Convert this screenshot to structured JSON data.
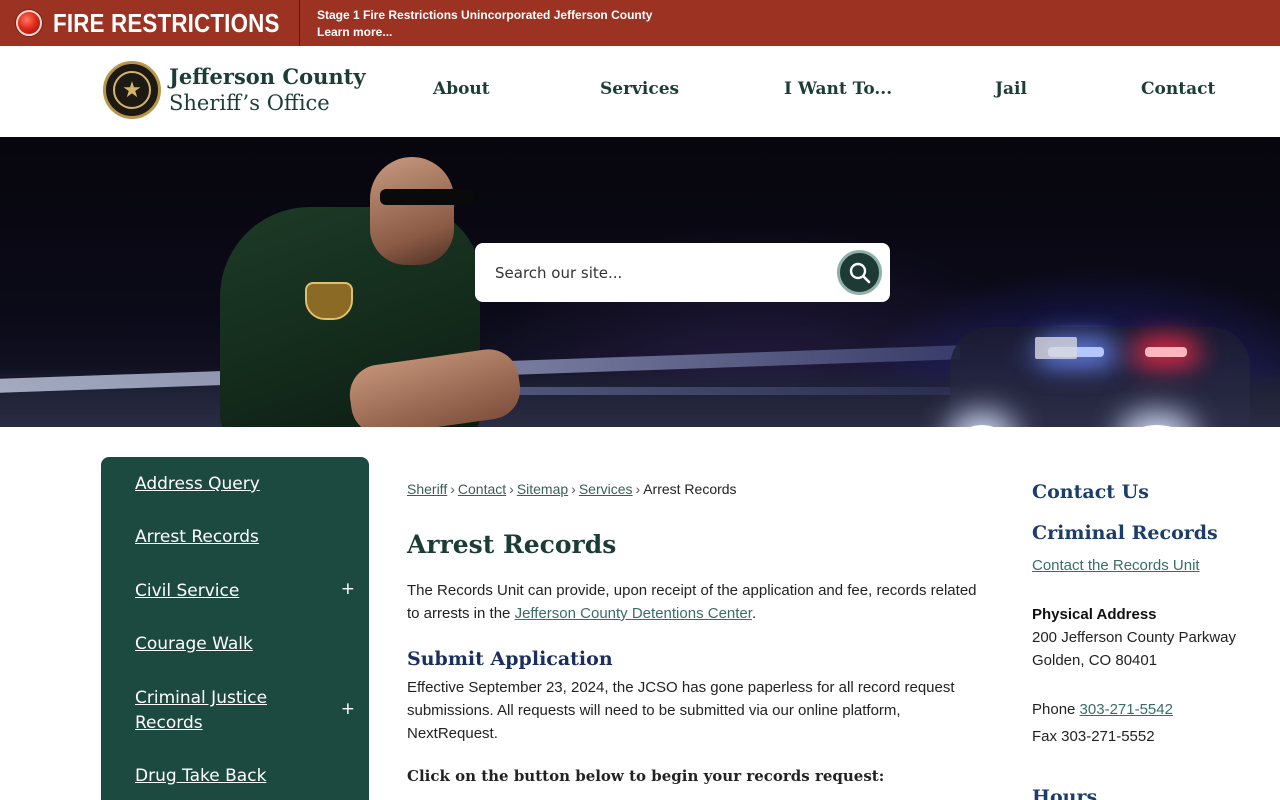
{
  "alert": {
    "title": "FIRE RESTRICTIONS",
    "message": "Stage 1 Fire Restrictions Unincorporated Jefferson County",
    "link": "Learn more..."
  },
  "header": {
    "logo_line1": "Jefferson County",
    "logo_line2": "Sheriff’s Office",
    "nav": [
      "About",
      "Services",
      "I Want To...",
      "Jail",
      "Contact"
    ]
  },
  "search": {
    "placeholder": "Search our site..."
  },
  "sidebar": {
    "items": [
      {
        "label": "Address Query",
        "expandable": false
      },
      {
        "label": "Arrest Records",
        "expandable": false
      },
      {
        "label": "Civil Service",
        "expandable": true
      },
      {
        "label": "Courage Walk",
        "expandable": false
      },
      {
        "label": "Criminal Justice Records",
        "expandable": true
      },
      {
        "label": "Drug Take Back",
        "expandable": false
      }
    ],
    "expand_symbol": "+"
  },
  "breadcrumb": {
    "links": [
      "Sheriff",
      "Contact",
      "Sitemap",
      "Services"
    ],
    "current": "Arrest Records",
    "separator": "›"
  },
  "main": {
    "title": "Arrest Records",
    "intro_text": "The Records Unit can provide, upon receipt of the application and fee, records related to arrests in the ",
    "intro_link": "Jefferson County Detentions Center",
    "intro_end": ".",
    "section_title": "Submit Application",
    "section_text": "Effective September 23, 2024, the JCSO has gone paperless for all record request submissions. All requests will need to be submitted via our online platform, NextRequest.",
    "cta_text": "Click on the button below to begin your records request:"
  },
  "contact": {
    "heading": "Contact Us",
    "subheading": "Criminal Records",
    "link": "Contact the Records Unit",
    "address_label": "Physical Address",
    "address_line1": "200 Jefferson County Parkway",
    "address_line2": "Golden, CO 80401",
    "phone_label": "Phone ",
    "phone": "303-271-5542",
    "fax": "Fax 303-271-5552",
    "hours_heading": "Hours"
  },
  "colors": {
    "alert_bg": "#9b3222",
    "brand_green": "#1b3d36",
    "sidebar_bg": "#1d4a40",
    "heading_blue": "#1b2f5c"
  },
  "icons": {
    "alert": "alert-dot-icon",
    "search": "search-icon",
    "badge": "sheriff-star-icon"
  }
}
